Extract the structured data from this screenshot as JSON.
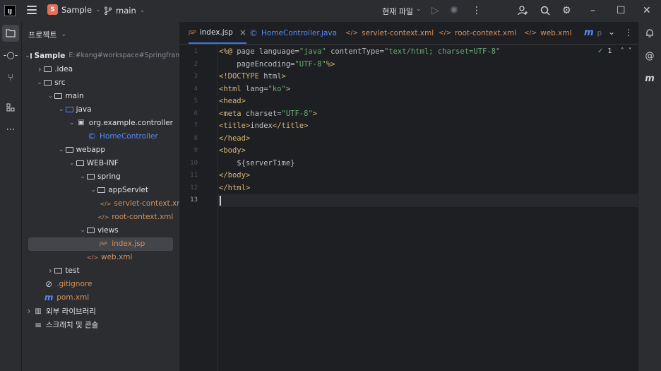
{
  "titlebar": {
    "logo": "IJ",
    "project_badge": "S",
    "project_name": "Sample",
    "branch": "main",
    "run_config": "현재 파일",
    "icons": [
      "run-icon",
      "debug-icon",
      "more-icon",
      "add-user-icon",
      "search-icon",
      "gear-icon",
      "minimize-icon",
      "maximize-icon",
      "close-icon"
    ]
  },
  "left_strip": {
    "icons": [
      "project-icon",
      "commit-icon",
      "pull-requests-icon",
      "structure-icon",
      "more-tools-icon"
    ]
  },
  "right_strip": {
    "icons": [
      "notifications-icon",
      "ai-assistant-icon",
      "maven-icon"
    ]
  },
  "project_panel": {
    "title": "프로젝트",
    "tree": [
      {
        "label": "Sample",
        "path": "E:#kang#workspace#Springframev",
        "depth": 0,
        "expanded": true,
        "kind": "module"
      },
      {
        "label": ".idea",
        "depth": 1,
        "expanded": false,
        "kind": "folder"
      },
      {
        "label": "src",
        "depth": 1,
        "expanded": true,
        "kind": "folder"
      },
      {
        "label": "main",
        "depth": 2,
        "expanded": true,
        "kind": "folder"
      },
      {
        "label": "java",
        "depth": 3,
        "expanded": true,
        "kind": "source-folder"
      },
      {
        "label": "org.example.controller",
        "depth": 4,
        "expanded": true,
        "kind": "package"
      },
      {
        "label": "HomeController",
        "depth": 5,
        "kind": "java-class"
      },
      {
        "label": "webapp",
        "depth": 3,
        "expanded": true,
        "kind": "folder"
      },
      {
        "label": "WEB-INF",
        "depth": 4,
        "expanded": true,
        "kind": "folder"
      },
      {
        "label": "spring",
        "depth": 5,
        "expanded": true,
        "kind": "folder"
      },
      {
        "label": "appServlet",
        "depth": 6,
        "expanded": true,
        "kind": "folder"
      },
      {
        "label": "servlet-context.xml",
        "depth": 7,
        "kind": "xml"
      },
      {
        "label": "root-context.xml",
        "depth": 6,
        "kind": "xml"
      },
      {
        "label": "views",
        "depth": 5,
        "expanded": true,
        "kind": "folder"
      },
      {
        "label": "index.jsp",
        "depth": 6,
        "kind": "jsp",
        "selected": true
      },
      {
        "label": "web.xml",
        "depth": 5,
        "kind": "xml"
      },
      {
        "label": "test",
        "depth": 2,
        "expanded": false,
        "kind": "folder"
      },
      {
        "label": ".gitignore",
        "depth": 1,
        "kind": "ignore"
      },
      {
        "label": "pom.xml",
        "depth": 1,
        "kind": "maven"
      },
      {
        "label": "외부 라이브러리",
        "depth": 0,
        "expanded": false,
        "kind": "libraries"
      },
      {
        "label": "스크래치 및 콘솔",
        "depth": 0,
        "kind": "scratches"
      }
    ]
  },
  "tabs": [
    {
      "label": "index.jsp",
      "icon": "JSP",
      "active": true,
      "closable": true
    },
    {
      "label": "HomeController.java",
      "icon": "©",
      "active": false
    },
    {
      "label": "servlet-context.xml",
      "icon": "</>",
      "active": false
    },
    {
      "label": "root-context.xml",
      "icon": "</>",
      "active": false
    },
    {
      "label": "web.xml",
      "icon": "</>",
      "active": false
    },
    {
      "label": "p",
      "icon": "m",
      "active": false
    }
  ],
  "editor": {
    "inspection_count": "1",
    "current_line": 13,
    "lines": [
      "<%@ page language=\"java\" contentType=\"text/html; charset=UTF-8\"",
      "    pageEncoding=\"UTF-8\"%>",
      "<!DOCTYPE html>",
      "<html lang=\"ko\">",
      "<head>",
      "<meta charset=\"UTF-8\">",
      "<title>index</title>",
      "</head>",
      "<body>",
      "    ${serverTime}",
      "</body>",
      "</html>",
      ""
    ]
  },
  "colors": {
    "accent": "#3574f0",
    "xml_icon": "#d6915c",
    "string": "#6aab73",
    "tag": "#d5b778"
  }
}
